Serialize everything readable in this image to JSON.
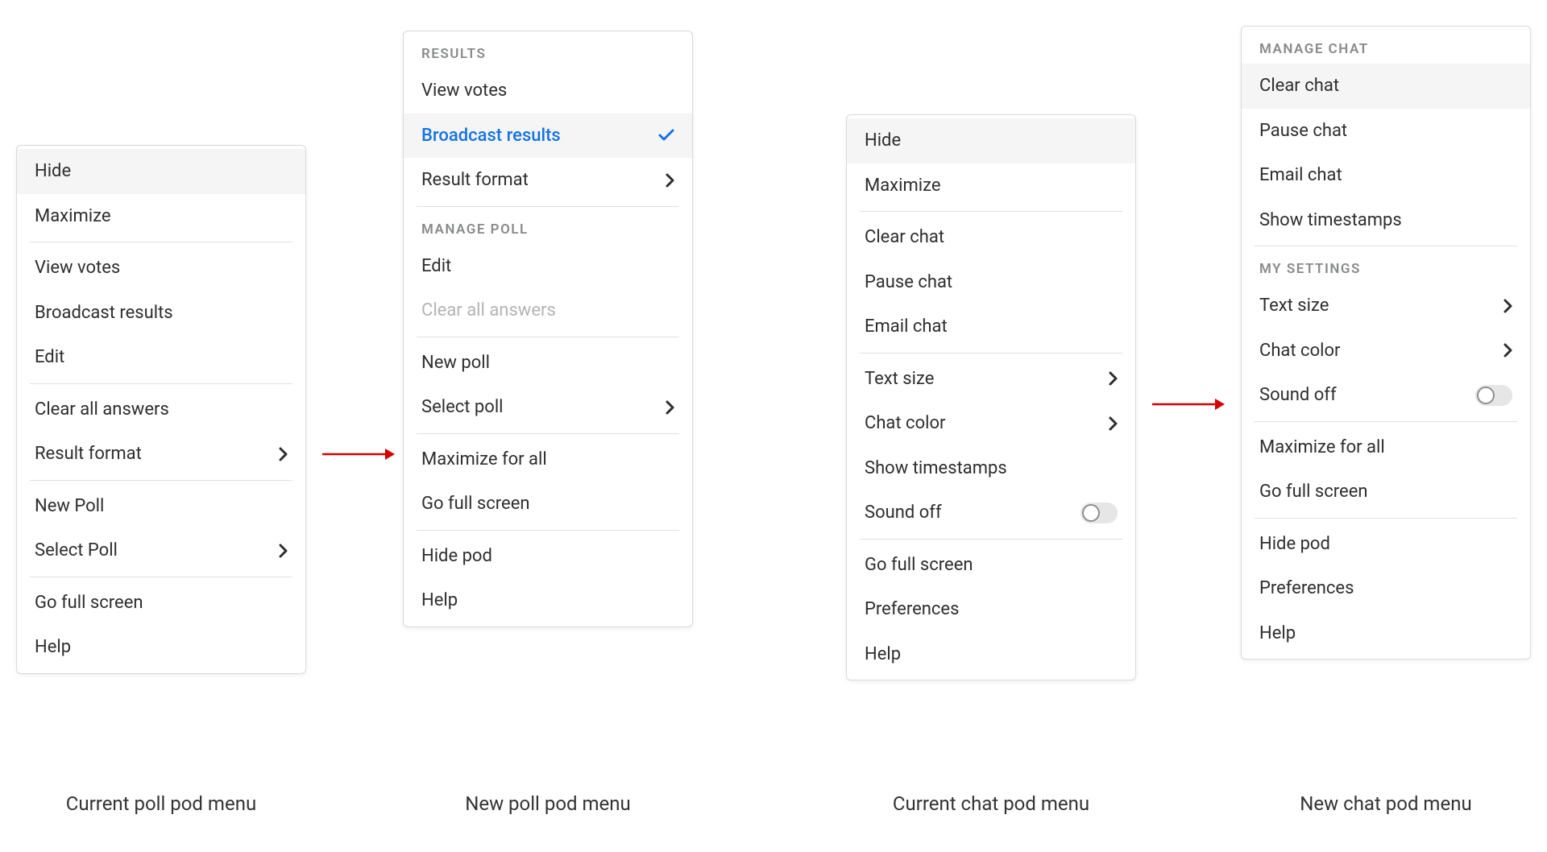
{
  "captions": {
    "currentPoll": "Current poll pod menu",
    "newPoll": "New poll pod menu",
    "currentChat": "Current chat pod menu",
    "newChat": "New chat pod menu"
  },
  "currentPollMenu": {
    "hide": "Hide",
    "maximize": "Maximize",
    "viewVotes": "View votes",
    "broadcastResults": "Broadcast results",
    "edit": "Edit",
    "clearAllAnswers": "Clear all answers",
    "resultFormat": "Result format",
    "newPoll": "New Poll",
    "selectPoll": "Select Poll",
    "goFullScreen": "Go full screen",
    "help": "Help"
  },
  "newPollMenu": {
    "sectionResults": "RESULTS",
    "viewVotes": "View votes",
    "broadcastResults": "Broadcast results",
    "resultFormat": "Result format",
    "sectionManage": "MANAGE POLL",
    "edit": "Edit",
    "clearAllAnswers": "Clear all answers",
    "newPoll": "New poll",
    "selectPoll": "Select poll",
    "maximizeForAll": "Maximize for all",
    "goFullScreen": "Go full screen",
    "hidePod": "Hide pod",
    "help": "Help"
  },
  "currentChatMenu": {
    "hide": "Hide",
    "maximize": "Maximize",
    "clearChat": "Clear chat",
    "pauseChat": "Pause chat",
    "emailChat": "Email chat",
    "textSize": "Text size",
    "chatColor": "Chat color",
    "showTimestamps": "Show timestamps",
    "soundOff": "Sound off",
    "goFullScreen": "Go full screen",
    "preferences": "Preferences",
    "help": "Help"
  },
  "newChatMenu": {
    "sectionManage": "MANAGE CHAT",
    "clearChat": "Clear chat",
    "pauseChat": "Pause chat",
    "emailChat": "Email chat",
    "showTimestamps": "Show timestamps",
    "sectionMySettings": "MY SETTINGS",
    "textSize": "Text size",
    "chatColor": "Chat color",
    "soundOff": "Sound off",
    "maximizeForAll": "Maximize for all",
    "goFullScreen": "Go full screen",
    "hidePod": "Hide pod",
    "preferences": "Preferences",
    "help": "Help"
  },
  "colors": {
    "selectedBlue": "#1473e6",
    "arrowRed": "#d40000"
  }
}
